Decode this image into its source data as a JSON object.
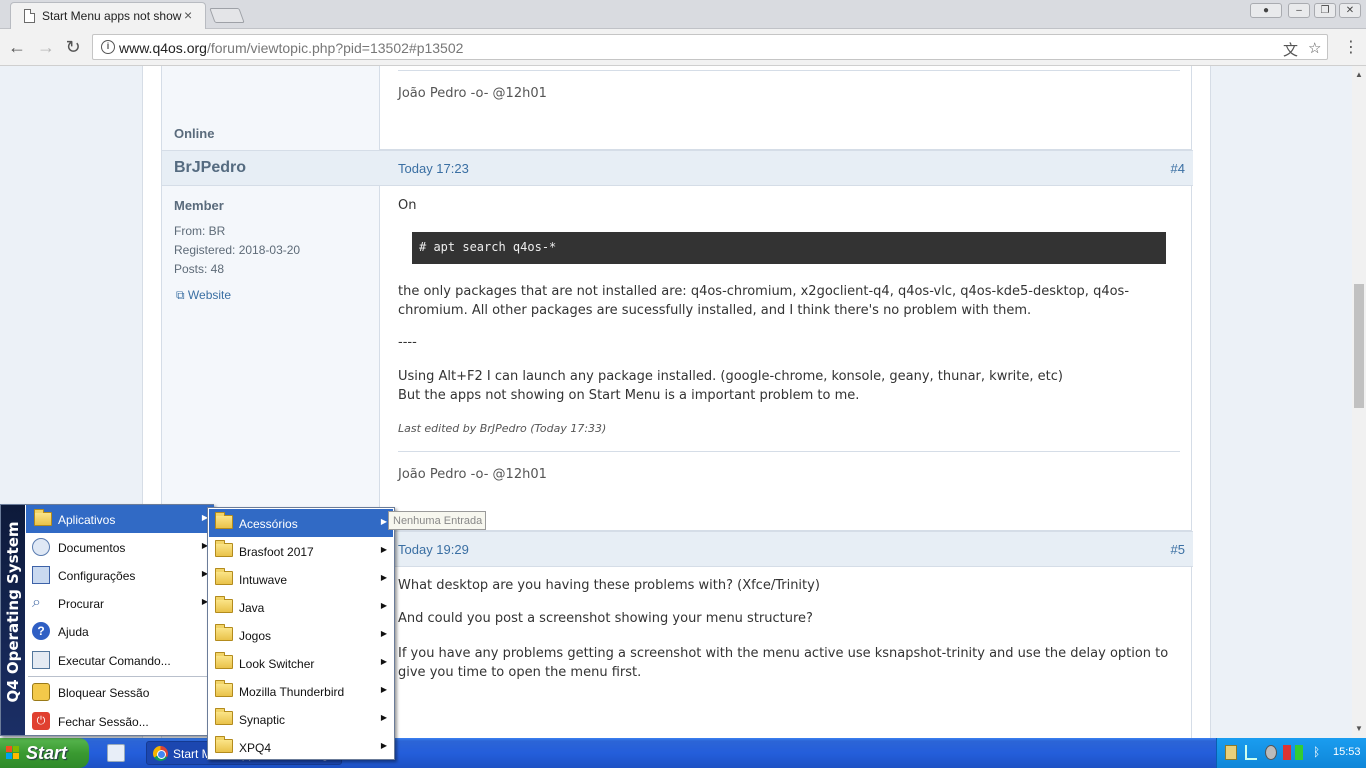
{
  "browser": {
    "tab_title": "Start Menu apps not showing",
    "tab_close": "×",
    "url_host": "www.q4os.org",
    "url_path": "/forum/viewtopic.php?pid=13502#p13502"
  },
  "posts": {
    "prev": {
      "signature": "João Pedro -o- @12h01",
      "status": "Online"
    },
    "p4": {
      "username": "BrJPedro",
      "date": "Today 17:23",
      "number": "#4",
      "role": "Member",
      "from": "From: BR",
      "registered": "Registered: 2018-03-20",
      "posts": "Posts: 48",
      "website": "Website",
      "line1": "On",
      "code": "# apt search q4os-*",
      "line2": "the only packages that are not installed are: q4os-chromium,  x2goclient-q4, q4os-vlc, q4os-kde5-desktop, q4os-chromium. All other packages are sucessfully installed, and I think there's no problem with them.",
      "line3": "----",
      "line4": "Using Alt+F2 I can launch any package installed. (google-chrome, konsole, geany, thunar, kwrite, etc)",
      "line5": "But the apps not showing on Start Menu is a important problem to me.",
      "edited": "Last edited by BrJPedro (Today 17:33)",
      "signature": "João Pedro -o- @12h01"
    },
    "p5": {
      "date": "Today 19:29",
      "number": "#5",
      "line1": "What desktop are you having these problems with? (Xfce/Trinity)",
      "line2": "And could you post a screenshot showing your menu structure?",
      "line3": "If you have any problems getting a screenshot with the menu active use ksnapshot-trinity and use the delay option to give you time to open the menu first."
    }
  },
  "start_menu": {
    "side_label": "Q4 Operating System",
    "items": [
      {
        "label": "Aplicativos",
        "icon": "folder-icon"
      },
      {
        "label": "Documentos",
        "icon": "documents-icon"
      },
      {
        "label": "Configurações",
        "icon": "settings-icon"
      },
      {
        "label": "Procurar",
        "icon": "search-icon"
      },
      {
        "label": "Ajuda",
        "icon": "help-icon"
      },
      {
        "label": "Executar Comando...",
        "icon": "run-icon"
      },
      {
        "label": "Bloquear Sessão",
        "icon": "lock-icon"
      },
      {
        "label": "Fechar Sessão...",
        "icon": "logout-icon"
      }
    ]
  },
  "submenu": {
    "items": [
      {
        "label": "Acessórios"
      },
      {
        "label": "Brasfoot 2017"
      },
      {
        "label": "Intuwave"
      },
      {
        "label": "Java"
      },
      {
        "label": "Jogos"
      },
      {
        "label": "Look Switcher"
      },
      {
        "label": "Mozilla Thunderbird"
      },
      {
        "label": "Synaptic"
      },
      {
        "label": "XPQ4"
      }
    ],
    "tooltip": "Nenhuma Entrada"
  },
  "taskbar": {
    "start_label": "Start",
    "task_label": "Start Menu apps not showing - Google Chrome",
    "clock": "15:53"
  },
  "colors": {
    "accent_blue": "#316ac5",
    "link": "#3a6fa3",
    "taskbar": "#245edb",
    "start_green": "#3a9a31"
  }
}
